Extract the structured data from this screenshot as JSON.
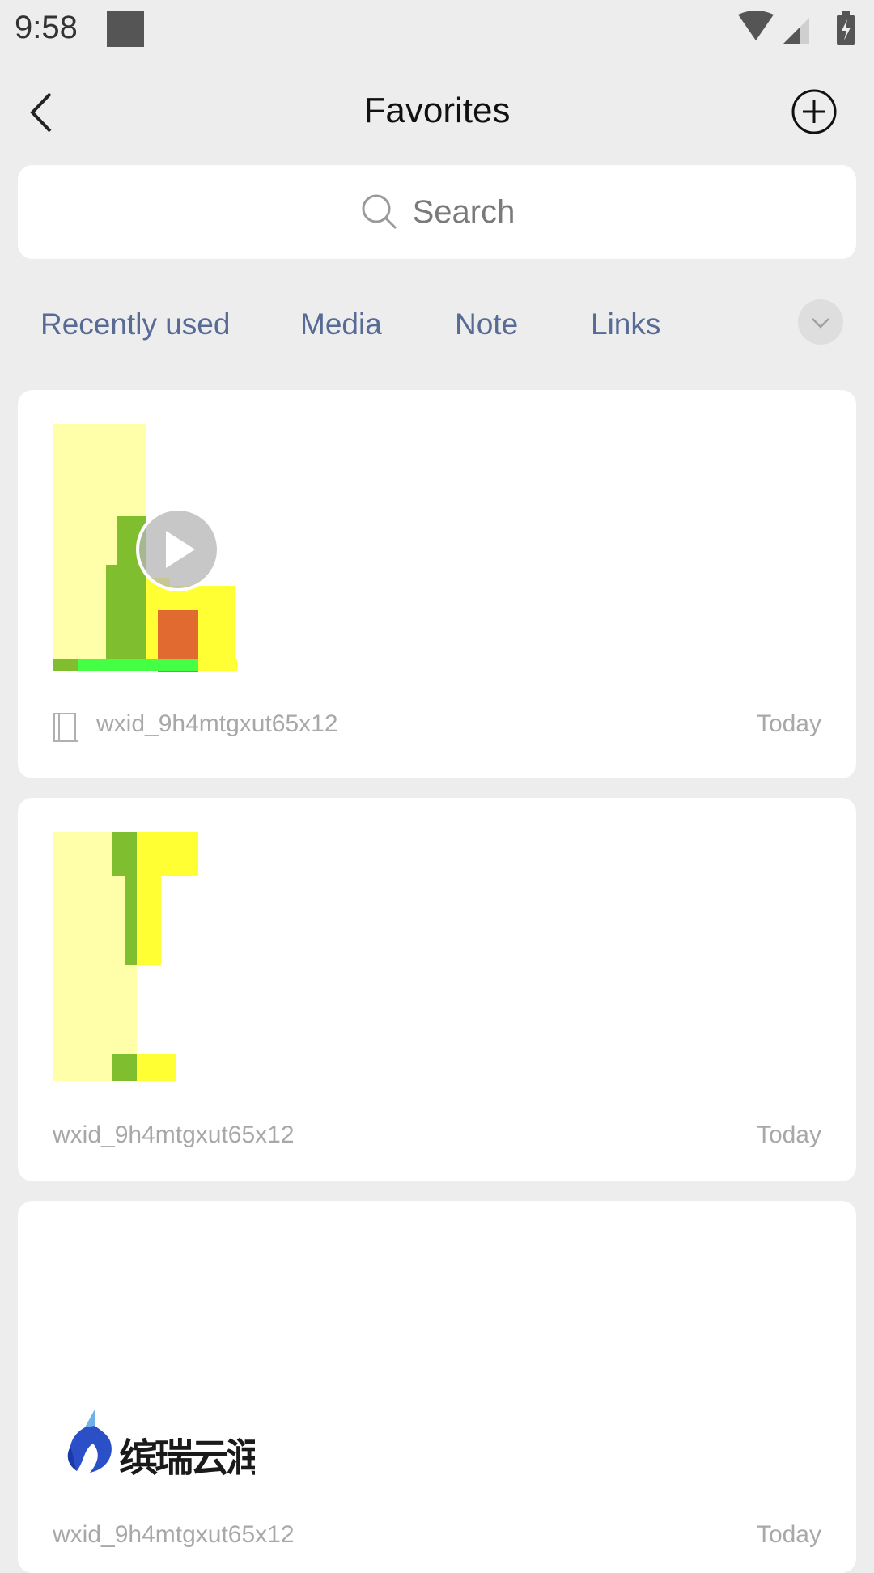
{
  "status_bar": {
    "time": "9:58"
  },
  "header": {
    "title": "Favorites"
  },
  "search": {
    "placeholder": "Search"
  },
  "tabs": [
    {
      "label": "Recently used"
    },
    {
      "label": "Media"
    },
    {
      "label": "Note"
    },
    {
      "label": "Links"
    }
  ],
  "items": [
    {
      "author": "wxid_9h4mtgxut65x12",
      "date": "Today",
      "type": "video"
    },
    {
      "author": "wxid_9h4mtgxut65x12",
      "date": "Today",
      "type": "image"
    },
    {
      "author": "wxid_9h4mtgxut65x12",
      "date": "Today",
      "type": "image",
      "logo_text": "缤瑞云润"
    }
  ],
  "colors": {
    "background": "#ededed",
    "tab_text": "#576b95",
    "meta_text": "#a8a8a8"
  }
}
